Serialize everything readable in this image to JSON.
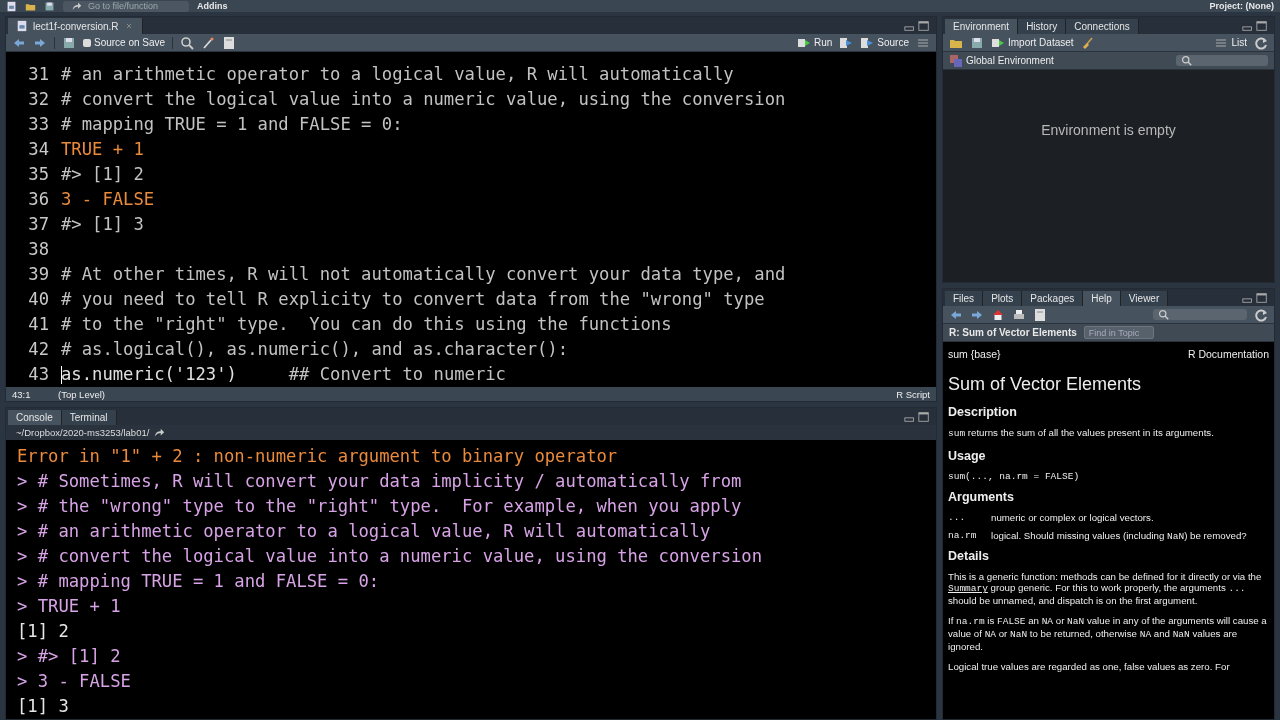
{
  "top_toolbar": {
    "go_to_file": "Go to file/function",
    "addins": "Addins",
    "project": "Project: (None)"
  },
  "editor": {
    "tabs": [
      {
        "label": "lect1f-conversion.R",
        "selected": true
      }
    ],
    "source_on_save": {
      "label": "Source on Save",
      "checked": false
    },
    "run": "Run",
    "source": "Source",
    "lines": [
      {
        "number": "31",
        "segments": [
          {
            "kind": "comment",
            "text": "# an arithmetic operator to a logical value, R will automatically"
          }
        ]
      },
      {
        "number": "32",
        "segments": [
          {
            "kind": "comment",
            "text": "# convert the logical value into a numeric value, using the conversion"
          }
        ]
      },
      {
        "number": "33",
        "segments": [
          {
            "kind": "comment",
            "text": "# mapping TRUE = 1 and FALSE = 0:"
          }
        ]
      },
      {
        "number": "34",
        "segments": [
          {
            "kind": "keyword",
            "text": "TRUE + 1"
          }
        ]
      },
      {
        "number": "35",
        "segments": [
          {
            "kind": "comment",
            "text": "#> [1] 2"
          }
        ]
      },
      {
        "number": "36",
        "segments": [
          {
            "kind": "keyword",
            "text": "3 - FALSE"
          }
        ]
      },
      {
        "number": "37",
        "segments": [
          {
            "kind": "comment",
            "text": "#> [1] 3"
          }
        ]
      },
      {
        "number": "38"
      },
      {
        "number": "39",
        "segments": [
          {
            "kind": "comment",
            "text": "# At other times, R will not automatically convert your data type, and"
          }
        ]
      },
      {
        "number": "40",
        "segments": [
          {
            "kind": "comment",
            "text": "# you need to tell R explicity to convert data from the \"wrong\" type"
          }
        ]
      },
      {
        "number": "41",
        "segments": [
          {
            "kind": "comment",
            "text": "# to the \"right\" type.  You can do this using the functions"
          }
        ]
      },
      {
        "number": "42",
        "segments": [
          {
            "kind": "comment",
            "text": "# as.logical(), as.numeric(), and as.character():"
          }
        ]
      },
      {
        "number": "43",
        "cursor": true,
        "segments": [
          {
            "kind": "plain",
            "text": "as.numeric('123')"
          },
          {
            "kind": "comment",
            "text": "     ## Convert to numeric"
          }
        ]
      }
    ],
    "cursor_position": "43:1",
    "scope": "(Top Level)",
    "file_type": "R Script"
  },
  "console": {
    "tabs": [
      {
        "label": "Console",
        "selected": true
      },
      {
        "label": "Terminal",
        "selected": false
      }
    ],
    "path": "~/Dropbox/2020-ms3253/lab01/",
    "lines": [
      {
        "kind": "error",
        "text": "Error in \"1\" + 2 : non-numeric argument to binary operator"
      },
      {
        "kind": "input",
        "text": "> # Sometimes, R will convert your data implicity / automatically from"
      },
      {
        "kind": "input",
        "text": "> # the \"wrong\" type to the \"right\" type.  For example, when you apply"
      },
      {
        "kind": "input",
        "text": "> # an arithmetic operator to a logical value, R will automatically"
      },
      {
        "kind": "input",
        "text": "> # convert the logical value into a numeric value, using the conversion"
      },
      {
        "kind": "input",
        "text": "> # mapping TRUE = 1 and FALSE = 0:"
      },
      {
        "kind": "input",
        "text": "> TRUE + 1"
      },
      {
        "kind": "output",
        "text": "[1] 2"
      },
      {
        "kind": "input",
        "text": "> #> [1] 2"
      },
      {
        "kind": "input",
        "text": "> 3 - FALSE"
      },
      {
        "kind": "output",
        "text": "[1] 3"
      }
    ]
  },
  "environment": {
    "tabs": [
      {
        "label": "Environment",
        "selected": true
      },
      {
        "label": "History",
        "selected": false
      },
      {
        "label": "Connections",
        "selected": false
      }
    ],
    "import_dataset": "Import Dataset",
    "view_mode": "List",
    "scope": "Global Environment",
    "empty_message": "Environment is empty"
  },
  "help": {
    "tabs": [
      {
        "label": "Files",
        "selected": false
      },
      {
        "label": "Plots",
        "selected": false
      },
      {
        "label": "Packages",
        "selected": false
      },
      {
        "label": "Help",
        "selected": true
      },
      {
        "label": "Viewer",
        "selected": false
      }
    ],
    "topic": "R: Sum of Vector Elements",
    "find_placeholder": "Find in Topic",
    "package": "sum {base}",
    "doc_label": "R Documentation",
    "title": "Sum of Vector Elements",
    "blocks": [
      {
        "kind": "heading",
        "text": "Description"
      },
      {
        "kind": "para",
        "segments": [
          {
            "kind": "code",
            "text": "sum"
          },
          {
            "kind": "text",
            "text": " returns the sum of all the values present in its arguments."
          }
        ]
      },
      {
        "kind": "heading",
        "text": "Usage"
      },
      {
        "kind": "usage",
        "text": "sum(..., na.rm = FALSE)"
      },
      {
        "kind": "heading",
        "text": "Arguments"
      },
      {
        "kind": "argument",
        "name": "...",
        "segments": [
          {
            "kind": "text",
            "text": "numeric or complex or logical vectors."
          }
        ]
      },
      {
        "kind": "argument",
        "name": "na.rm",
        "segments": [
          {
            "kind": "text",
            "text": "logical. Should missing values (including "
          },
          {
            "kind": "code",
            "text": "NaN"
          },
          {
            "kind": "text",
            "text": ") be removed?"
          }
        ]
      },
      {
        "kind": "heading",
        "text": "Details"
      },
      {
        "kind": "para",
        "segments": [
          {
            "kind": "text",
            "text": "This is a generic function: methods can be defined for it directly or via the "
          },
          {
            "kind": "link",
            "text": "Summary"
          },
          {
            "kind": "text",
            "text": " group generic. For this to work properly, the arguments "
          },
          {
            "kind": "code",
            "text": "..."
          },
          {
            "kind": "text",
            "text": " should be unnamed, and dispatch is on the first argument."
          }
        ]
      },
      {
        "kind": "para",
        "segments": [
          {
            "kind": "text",
            "text": "If "
          },
          {
            "kind": "code",
            "text": "na.rm"
          },
          {
            "kind": "text",
            "text": " is "
          },
          {
            "kind": "code",
            "text": "FALSE"
          },
          {
            "kind": "text",
            "text": " an "
          },
          {
            "kind": "code",
            "text": "NA"
          },
          {
            "kind": "text",
            "text": " or "
          },
          {
            "kind": "code",
            "text": "NaN"
          },
          {
            "kind": "text",
            "text": " value in any of the arguments will cause a value of "
          },
          {
            "kind": "code",
            "text": "NA"
          },
          {
            "kind": "text",
            "text": " or "
          },
          {
            "kind": "code",
            "text": "NaN"
          },
          {
            "kind": "text",
            "text": " to be returned, otherwise "
          },
          {
            "kind": "code",
            "text": "NA"
          },
          {
            "kind": "text",
            "text": " and "
          },
          {
            "kind": "code",
            "text": "NaN"
          },
          {
            "kind": "text",
            "text": " values are ignored."
          }
        ]
      },
      {
        "kind": "para",
        "segments": [
          {
            "kind": "text",
            "text": "Logical true values are regarded as one, false values as zero. For"
          }
        ]
      }
    ]
  }
}
